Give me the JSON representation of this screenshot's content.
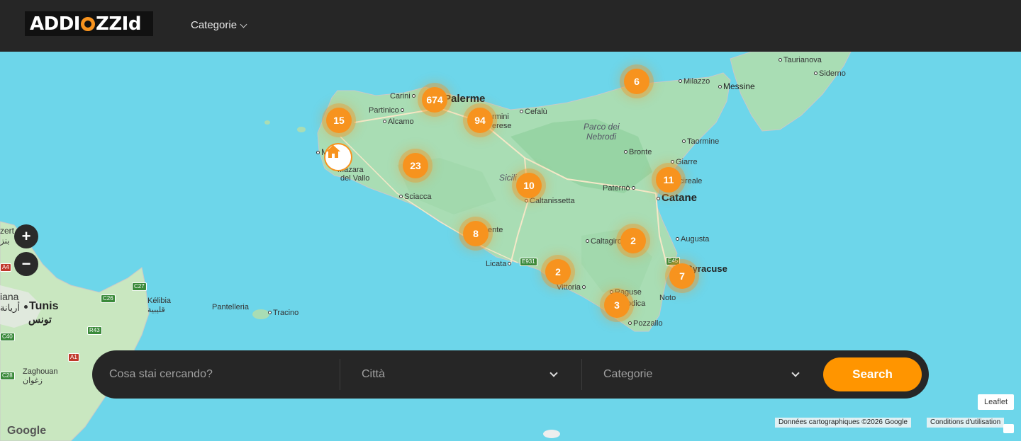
{
  "header": {
    "logo_text": "ADDIOZZId",
    "menu_categorie": "Categorie"
  },
  "map": {
    "places": {
      "palermo": "Palerme",
      "catania": "Catane",
      "messina": "Messine",
      "tunis": "Tunis",
      "tunis_ar": "تونس",
      "trapani": "Mazara",
      "mazara": "Mazara",
      "del_vallo": "del Vallo",
      "carini": "Carini",
      "partinico": "Partinico",
      "alcamo": "Alcamo",
      "termini": "rmini",
      "imerese": "erese",
      "cefalu": "Cefalù",
      "milazzo": "Milazzo",
      "taurianova": "Taurianova",
      "siderno": "Siderno",
      "nebrodi_1": "Parco dei",
      "nebrodi_2": "Nebrodi",
      "taormina": "Taormine",
      "bronte": "Bronte",
      "giarre": "Giarre",
      "acireale": "cireale",
      "paterno": "Paternò",
      "sicilia": "Sicili",
      "caltanissetta": "Caltanissetta",
      "sciacca": "Sciacca",
      "agrigento": "ente",
      "licata": "Licata",
      "caltagirone": "Caltagiro",
      "augusta": "Augusta",
      "siracusa": "Syracuse",
      "vittoria": "Vittoria",
      "ragusa": "Raguse",
      "modica": "odica",
      "noto": "Noto",
      "pozzallo": "Pozzallo",
      "pantelleria": "Pantelleria",
      "tracino": "Tracino",
      "kelibia": "Kélibia",
      "kelibia_ar": "قليبية",
      "zaghouan": "Zaghouan",
      "zaghouan_ar": "زغوان",
      "ariana": "iana",
      "ariana_ar": "أريانة",
      "bizerte": "zert",
      "bizerte_ar": "بنز"
    },
    "roads": {
      "e931": "E931",
      "e45": "E45",
      "c27": "C27",
      "c26": "C26",
      "r43": "R43",
      "a1": "A1",
      "c40": "C40",
      "c28": "C28",
      "a4": "A4"
    },
    "clusters": [
      "674",
      "15",
      "94",
      "6",
      "23",
      "10",
      "11",
      "8",
      "2",
      "2",
      "7",
      "3"
    ],
    "zoom_in": "+",
    "zoom_out": "−"
  },
  "search": {
    "placeholder": "Cosa stai cercando?",
    "city_label": "Città",
    "category_label": "Categorie",
    "button_label": "Search"
  },
  "attribution": {
    "leaflet": "Leaflet",
    "map_data": "Données cartographiques ©2026 Google",
    "terms": "Conditions d'utilisation",
    "google": "Google"
  }
}
